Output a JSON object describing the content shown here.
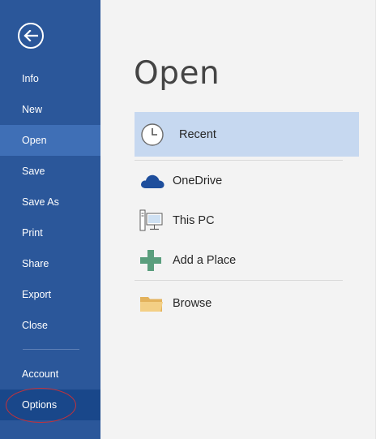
{
  "sidebar": {
    "back_icon": "back-arrow-icon",
    "items": [
      {
        "label": "Info"
      },
      {
        "label": "New"
      },
      {
        "label": "Open"
      },
      {
        "label": "Save"
      },
      {
        "label": "Save As"
      },
      {
        "label": "Print"
      },
      {
        "label": "Share"
      },
      {
        "label": "Export"
      },
      {
        "label": "Close"
      },
      {
        "label": "Account"
      },
      {
        "label": "Options"
      }
    ],
    "selected": "Open",
    "highlighted": "Options",
    "colors": {
      "background": "#2b579a",
      "selected": "#3f6fb6",
      "highlighted": "#19478a",
      "annotation_circle": "#c4323a"
    }
  },
  "main": {
    "title": "Open",
    "places": [
      {
        "label": "Recent",
        "icon": "clock-icon",
        "selected": true
      },
      {
        "label": "OneDrive",
        "icon": "cloud-icon"
      },
      {
        "label": "This PC",
        "icon": "computer-icon"
      },
      {
        "label": "Add a Place",
        "icon": "plus-icon"
      },
      {
        "label": "Browse",
        "icon": "folder-icon"
      }
    ],
    "colors": {
      "selected_place": "#c6d8f0",
      "background": "#f3f3f3"
    }
  }
}
